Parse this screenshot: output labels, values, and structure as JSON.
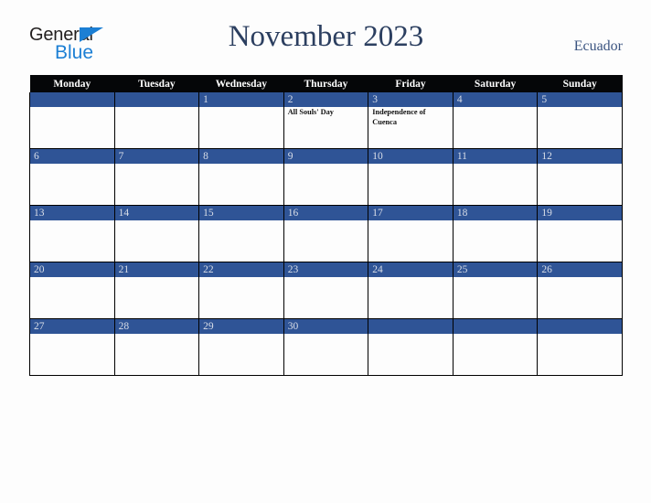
{
  "brand": {
    "name_part1": "General",
    "name_part2": "Blue",
    "triangle_icon": "triangle-icon",
    "color_dark": "#221f1f",
    "color_blue": "#1c7fd4"
  },
  "header": {
    "title": "November 2023",
    "country": "Ecuador",
    "title_color": "#2c3f60",
    "country_color": "#3b5480"
  },
  "calendar": {
    "month": "November",
    "year": "2023",
    "weekday_headers": [
      "Monday",
      "Tuesday",
      "Wednesday",
      "Thursday",
      "Friday",
      "Saturday",
      "Sunday"
    ],
    "header_bg": "#050608",
    "daybar_bg": "#2f5496",
    "daybar_text_color": "#d9dee8",
    "cell_bg": "#fdfdfd",
    "weeks": [
      [
        {
          "day": "",
          "events": ""
        },
        {
          "day": "",
          "events": ""
        },
        {
          "day": "1",
          "events": ""
        },
        {
          "day": "2",
          "events": "All Souls' Day"
        },
        {
          "day": "3",
          "events": "Independence of Cuenca"
        },
        {
          "day": "4",
          "events": ""
        },
        {
          "day": "5",
          "events": ""
        }
      ],
      [
        {
          "day": "6",
          "events": ""
        },
        {
          "day": "7",
          "events": ""
        },
        {
          "day": "8",
          "events": ""
        },
        {
          "day": "9",
          "events": ""
        },
        {
          "day": "10",
          "events": ""
        },
        {
          "day": "11",
          "events": ""
        },
        {
          "day": "12",
          "events": ""
        }
      ],
      [
        {
          "day": "13",
          "events": ""
        },
        {
          "day": "14",
          "events": ""
        },
        {
          "day": "15",
          "events": ""
        },
        {
          "day": "16",
          "events": ""
        },
        {
          "day": "17",
          "events": ""
        },
        {
          "day": "18",
          "events": ""
        },
        {
          "day": "19",
          "events": ""
        }
      ],
      [
        {
          "day": "20",
          "events": ""
        },
        {
          "day": "21",
          "events": ""
        },
        {
          "day": "22",
          "events": ""
        },
        {
          "day": "23",
          "events": ""
        },
        {
          "day": "24",
          "events": ""
        },
        {
          "day": "25",
          "events": ""
        },
        {
          "day": "26",
          "events": ""
        }
      ],
      [
        {
          "day": "27",
          "events": ""
        },
        {
          "day": "28",
          "events": ""
        },
        {
          "day": "29",
          "events": ""
        },
        {
          "day": "30",
          "events": ""
        },
        {
          "day": "",
          "events": ""
        },
        {
          "day": "",
          "events": ""
        },
        {
          "day": "",
          "events": ""
        }
      ]
    ]
  }
}
